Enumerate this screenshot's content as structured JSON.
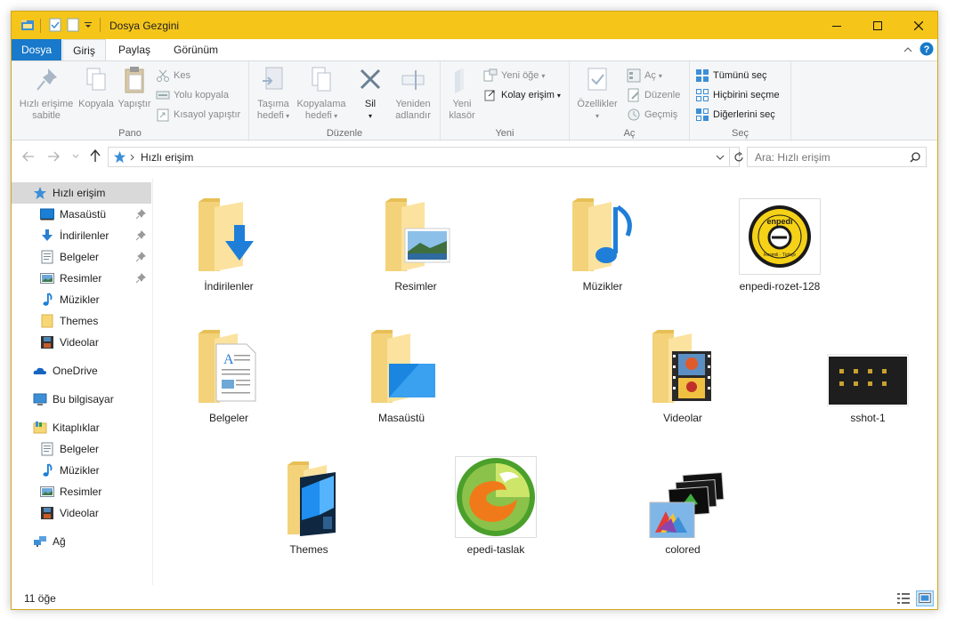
{
  "window": {
    "title": "Dosya Gezgini",
    "accent_color": "#f5c51a"
  },
  "ribbon_tabs": [
    {
      "label": "Dosya"
    },
    {
      "label": "Giriş"
    },
    {
      "label": "Paylaş"
    },
    {
      "label": "Görünüm"
    }
  ],
  "ribbon": {
    "pano": {
      "label": "Pano",
      "pin": "Hızlı erişime sabitle",
      "copy": "Kopyala",
      "paste": "Yapıştır",
      "cut": "Kes",
      "copy_path": "Yolu kopyala",
      "paste_shortcut": "Kısayol yapıştır"
    },
    "duzenle": {
      "label": "Düzenle",
      "move_to": "Taşıma hedefi",
      "copy_to": "Kopyalama hedefi",
      "delete": "Sil",
      "rename": "Yeniden adlandır"
    },
    "yeni": {
      "label": "Yeni",
      "new_folder": "Yeni klasör",
      "new_item": "Yeni öğe",
      "easy_access": "Kolay erişim"
    },
    "ac": {
      "label": "Aç",
      "properties": "Özellikler",
      "open": "Aç",
      "edit": "Düzenle",
      "history": "Geçmiş"
    },
    "sec": {
      "label": "Seç",
      "select_all": "Tümünü seç",
      "select_none": "Hiçbirini seçme",
      "invert": "Diğerlerini seç"
    }
  },
  "address": {
    "path": "Hızlı erişim",
    "search_placeholder": "Ara: Hızlı erişim"
  },
  "sidebar": {
    "quick_access": "Hızlı erişim",
    "quick_items": [
      {
        "label": "Masaüstü",
        "pinned": true
      },
      {
        "label": "İndirilenler",
        "pinned": true
      },
      {
        "label": "Belgeler",
        "pinned": true
      },
      {
        "label": "Resimler",
        "pinned": true
      },
      {
        "label": "Müzikler",
        "pinned": false
      },
      {
        "label": "Themes",
        "pinned": false
      },
      {
        "label": "Videolar",
        "pinned": false
      }
    ],
    "onedrive": "OneDrive",
    "this_pc": "Bu bilgisayar",
    "libraries": "Kitaplıklar",
    "library_items": [
      {
        "label": "Belgeler"
      },
      {
        "label": "Müzikler"
      },
      {
        "label": "Resimler"
      },
      {
        "label": "Videolar"
      }
    ],
    "network": "Ağ"
  },
  "content": {
    "items": [
      {
        "name": "İndirilenler"
      },
      {
        "name": "Resimler"
      },
      {
        "name": "Müzikler"
      },
      {
        "name": "enpedi-rozet-128"
      },
      {
        "name": "Belgeler"
      },
      {
        "name": "Masaüstü"
      },
      {
        "name": "Videolar"
      },
      {
        "name": "sshot-1"
      },
      {
        "name": "Themes"
      },
      {
        "name": "epedi-taslak"
      },
      {
        "name": "colored"
      }
    ],
    "badge_text": "enpedi",
    "badge_subtext": "Resimli · Türkçe"
  },
  "status": {
    "count": "11 öğe"
  }
}
